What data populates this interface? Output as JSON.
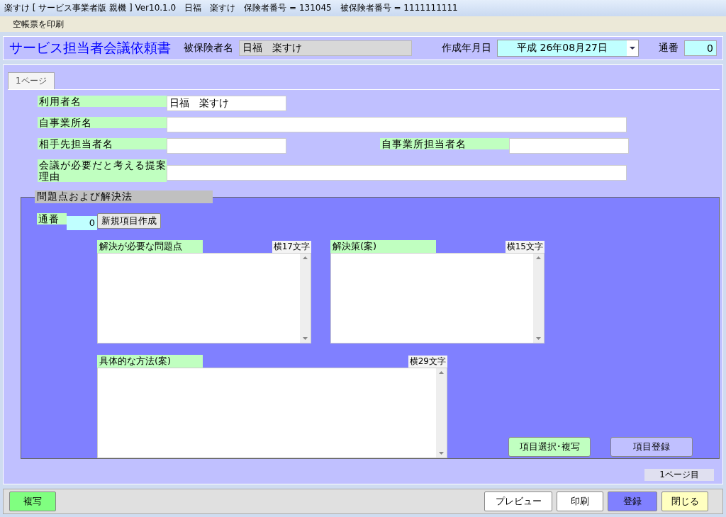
{
  "window": {
    "title": "楽すけ [ サービス事業者版 親機 ] Ver10.1.0　日福　楽すけ　保険者番号 = 131045　被保険者番号 = 1111111111"
  },
  "menu": [
    {
      "label": "空帳票を印刷"
    }
  ],
  "header": {
    "title": "サービス担当者会議依頼書",
    "insured_label": "被保険者名",
    "insured_value": "日福　楽すけ",
    "date_label": "作成年月日",
    "date_value": "平成 26年08月27日",
    "serial_label": "通番",
    "serial_value": "0"
  },
  "tabs": [
    {
      "label": "1ページ",
      "selected": true
    }
  ],
  "form_rows": [
    {
      "fields": [
        {
          "label": "利用者名",
          "value": "日福　楽すけ"
        }
      ]
    },
    {
      "fields": [
        {
          "label": "自事業所名"
        }
      ]
    },
    {
      "fields": [
        {
          "label": "相手先担当者名"
        },
        {
          "label": "自事業所担当者名"
        }
      ]
    },
    {
      "fields": [
        {
          "label": "会議が必要だと考える提案理由"
        }
      ]
    }
  ],
  "problems": {
    "legend": "問題点および解決法",
    "serial_label": "通番",
    "serial_value": "0",
    "new_button": "新規項目作成",
    "textareas": [
      {
        "label": "解決が必要な問題点",
        "limit": "横17文字"
      },
      {
        "label": "解決策(案)",
        "limit": "横15文字"
      },
      {
        "label": "具体的な方法(案)",
        "limit": "横29文字"
      }
    ],
    "buttons": [
      {
        "label": "項目選択･複写",
        "color": "#c0ffc0"
      },
      {
        "label": "項目登録",
        "color": "#c0c0ff"
      }
    ]
  },
  "page_indicator": "1ページ目",
  "footer": {
    "left_buttons": [
      {
        "label": "複写",
        "color": "#80ff80"
      }
    ],
    "right_buttons": [
      {
        "label": "プレビュー",
        "color": "#ffffff"
      },
      {
        "label": "印刷",
        "color": "#ffffff"
      },
      {
        "label": "登録",
        "color": "#8080ff"
      },
      {
        "label": "閉じる",
        "color": "#ffffc0"
      }
    ]
  }
}
